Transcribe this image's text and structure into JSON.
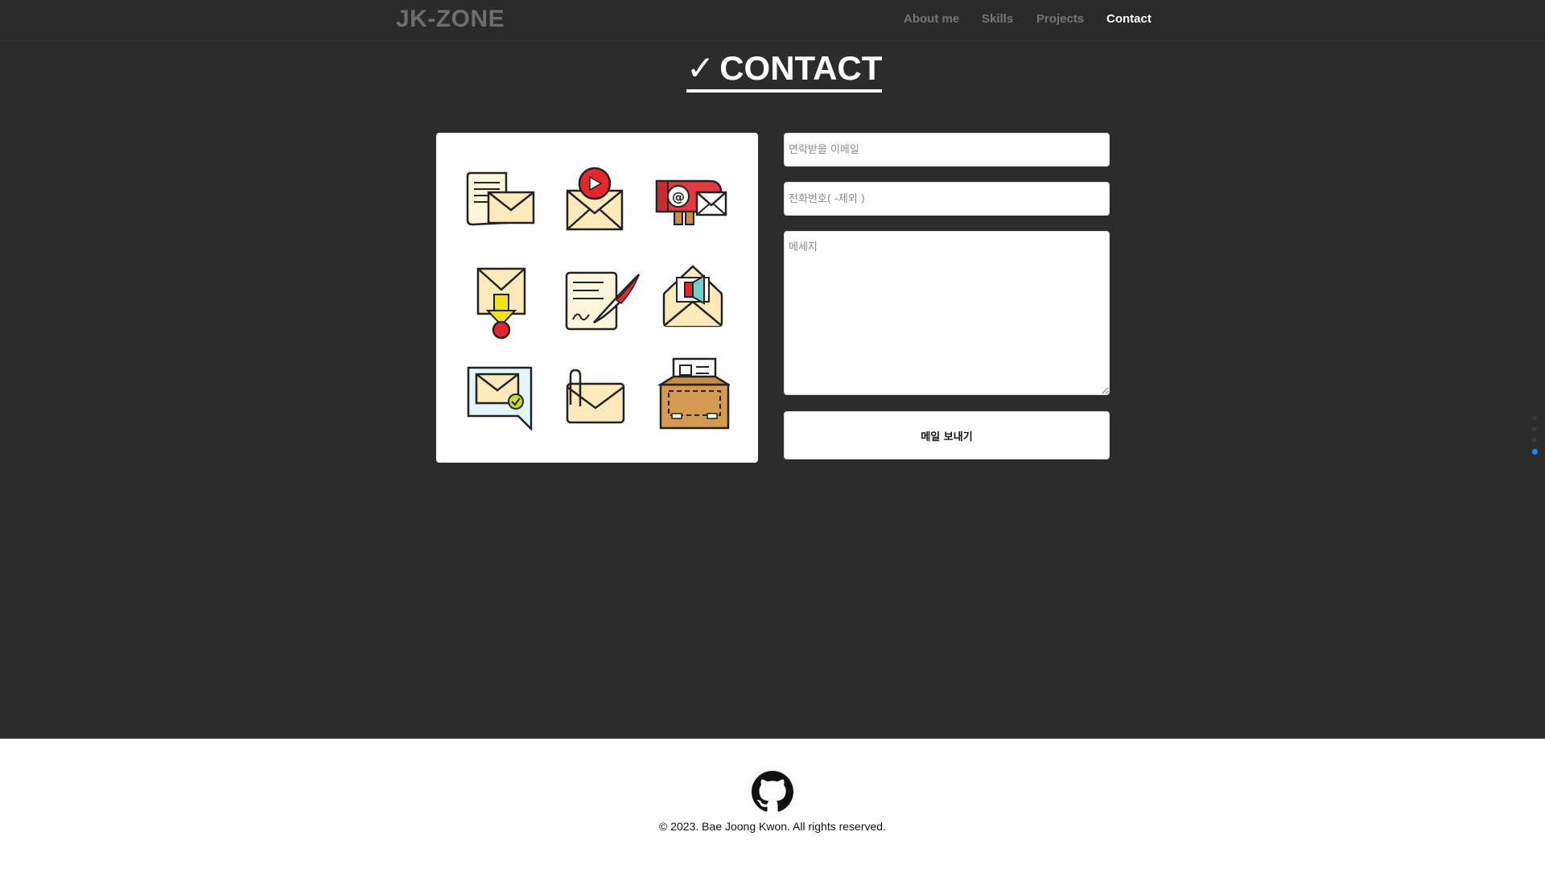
{
  "nav": {
    "brand": "JK-ZONE",
    "links": [
      "About me",
      "Skills",
      "Projects",
      "Contact"
    ],
    "active": "Contact"
  },
  "section": {
    "check": "✓",
    "title": "CONTACT"
  },
  "form": {
    "email_placeholder": "연락받을 이메일",
    "phone_placeholder": "전화번호( -제외 )",
    "message_placeholder": "메세지",
    "send_label": "메일 보내기"
  },
  "icons": [
    "document-mail-icon",
    "video-mail-icon",
    "mailbox-at-icon",
    "mail-download-icon",
    "signature-document-icon",
    "megaphone-mail-icon",
    "mail-chat-check-icon",
    "mail-attachment-icon",
    "briefcase-mail-icon"
  ],
  "page_indicator": {
    "count": 4,
    "active_index": 3
  },
  "footer": {
    "icon": "github-icon",
    "copyright": "© 2023. Bae Joong Kwon. All rights reserved."
  },
  "colors": {
    "background": "#2c2c2c",
    "accent": "#1e88ff",
    "nav_inactive": "#757575"
  }
}
